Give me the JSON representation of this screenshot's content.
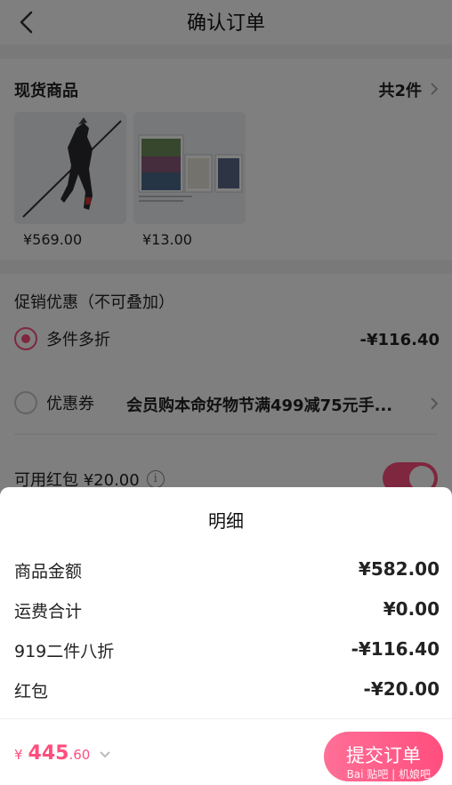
{
  "nav": {
    "title": "确认订单"
  },
  "goods": {
    "title": "现货商品",
    "count": "共2件",
    "items": [
      {
        "price": "¥569.00"
      },
      {
        "price": "¥13.00"
      }
    ]
  },
  "promo": {
    "title": "促销优惠（不可叠加）",
    "option1_label": "多件多折",
    "option1_value": "-¥116.40",
    "option2_label": "优惠券",
    "option2_desc": "会员购本命好物节满499减75元手...",
    "redpack_label": "可用红包 ¥20.00",
    "redpack_toggle_on": true
  },
  "sheet": {
    "title": "明细",
    "rows": [
      {
        "label": "商品金额",
        "value": "¥582.00"
      },
      {
        "label": "运费合计",
        "value": "¥0.00"
      },
      {
        "label": "919二件八折",
        "value": "-¥116.40"
      },
      {
        "label": "红包",
        "value": "-¥20.00"
      }
    ]
  },
  "footer": {
    "currency": "¥",
    "total_int": "445",
    "total_dec": ".60",
    "submit_label": "提交订单",
    "watermark": "Bai 贴吧 | 机娘吧"
  },
  "colors": {
    "accent": "#ff4e7e"
  }
}
